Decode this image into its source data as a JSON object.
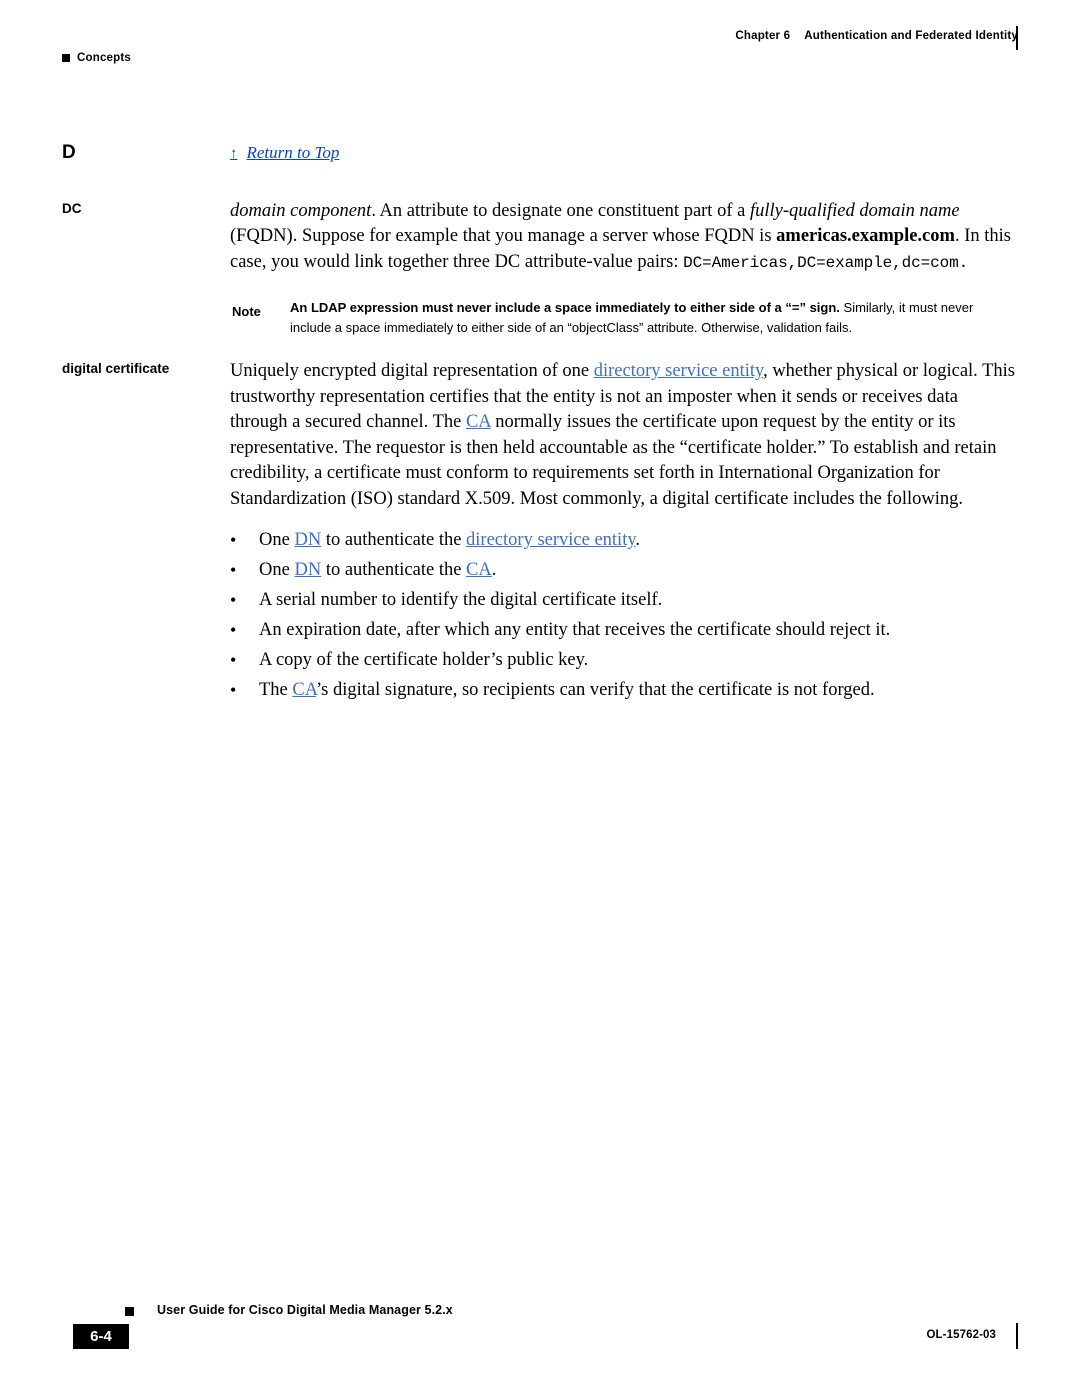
{
  "header": {
    "left_marker": "square-bullet",
    "left_text": "Concepts",
    "chapter_label": "Chapter 6",
    "chapter_title": "Authentication and Federated Identity"
  },
  "glossary": {
    "letter": "D",
    "return_to_top": {
      "arrow": "↑",
      "label": "Return to Top"
    },
    "entries": [
      {
        "term": "DC",
        "paragraph": {
          "p1_italic": "domain component",
          "p1_a": ". An attribute to designate one constituent part of a ",
          "p1_italic2": "fully-qualified domain name",
          "p1_b": " (FQDN). Suppose for example that you manage a server whose FQDN is ",
          "p1_bold": "americas.example.com",
          "p1_c": ". In this case, you would link together three DC attribute-value pairs: ",
          "p1_mono": "DC=Americas,DC=example,dc=com."
        },
        "note": {
          "label": "Note",
          "bold_text": "An LDAP expression must never include a space immediately to either side of a “=” sign.",
          "rest_text": " Similarly, it must never include a space immediately to either side of an “objectClass” attribute. Otherwise, validation fails."
        }
      },
      {
        "term": "digital certificate",
        "body": {
          "seg1": "Uniquely encrypted digital representation of one ",
          "link1": "directory service entity",
          "seg2": ", whether physical or logical. This trustworthy representation certifies that the entity is not an imposter when it sends or receives data through a secured channel. The ",
          "link2": "CA",
          "seg3": " normally issues the certificate upon request by the entity or its representative. The requestor is then held accountable as the “certificate holder.” To establish and retain credibility, a certificate must conform to requirements set forth in International Organization for Standardization (ISO) standard X.509. Most commonly, a digital certificate includes the following."
        },
        "bullets": [
          {
            "dot": "•",
            "seg1": "One ",
            "link1": "DN",
            "seg2": " to authenticate the ",
            "link2": "directory service entity",
            "seg3": "."
          },
          {
            "dot": "•",
            "seg1": "One ",
            "link1": "DN",
            "seg2": " to authenticate the ",
            "link2": "CA",
            "seg3": "."
          },
          {
            "dot": "•",
            "seg1": "A serial number to identify the digital certificate itself.",
            "link1": "",
            "seg2": "",
            "link2": "",
            "seg3": ""
          },
          {
            "dot": "•",
            "seg1": "An expiration date, after which any entity that receives the certificate should reject it.",
            "link1": "",
            "seg2": "",
            "link2": "",
            "seg3": ""
          },
          {
            "dot": "•",
            "seg1": "A copy of the certificate holder’s public key.",
            "link1": "",
            "seg2": "",
            "link2": "",
            "seg3": ""
          },
          {
            "dot": "•",
            "seg1": "The ",
            "link1": "CA",
            "seg2": "’s digital signature, so recipients can verify that the certificate is not forged.",
            "link2": "",
            "seg3": ""
          }
        ]
      }
    ]
  },
  "footer": {
    "guide_title": "User Guide for Cisco Digital Media Manager 5.2.x",
    "page_number": "6-4",
    "doc_id": "OL-15762-03"
  },
  "colors": {
    "link": "#3d6ec8",
    "return_link": "#0645c8",
    "text": "#000000"
  }
}
